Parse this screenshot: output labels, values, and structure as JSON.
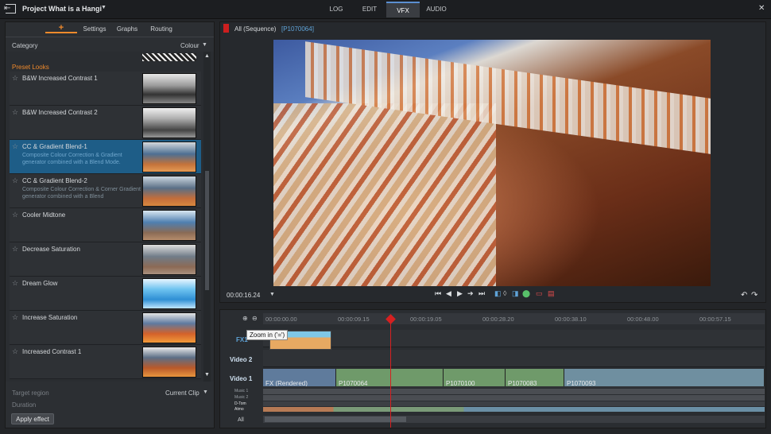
{
  "app": {
    "project_title": "Project What is a Hangi",
    "close": "✕"
  },
  "modes": [
    "LOG",
    "EDIT",
    "VFX",
    "AUDIO"
  ],
  "active_mode": "VFX",
  "left_panel": {
    "tabs": {
      "add": "+",
      "settings": "Settings",
      "graphs": "Graphs",
      "routing": "Routing"
    },
    "category_label": "Category",
    "category_value": "Colour",
    "section": "Preset Looks",
    "items": [
      {
        "label": "B&W Increased Contrast 1",
        "desc": ""
      },
      {
        "label": "B&W Increased Contrast 2",
        "desc": ""
      },
      {
        "label": "CC & Gradient Blend-1",
        "desc": "Composite Colour Correction & Gradient generator combined with a Blend Mode."
      },
      {
        "label": "CC & Gradient Blend-2",
        "desc": "Composite Colour Correction & Corner Gradient generator combined with a Blend"
      },
      {
        "label": "Cooler Midtone",
        "desc": ""
      },
      {
        "label": "Decrease Saturation",
        "desc": ""
      },
      {
        "label": "Dream Glow",
        "desc": ""
      },
      {
        "label": "Increase Saturation",
        "desc": ""
      },
      {
        "label": "Increased Contrast 1",
        "desc": ""
      }
    ],
    "target_region_label": "Target region",
    "target_region_value": "Current Clip",
    "duration_label": "Duration",
    "apply_button": "Apply effect"
  },
  "viewer": {
    "sequence": "All (Sequence)",
    "clip": "[P1070064]",
    "timecode": "00:00:16.24"
  },
  "timeline": {
    "timecodes": [
      "00:00:00.00",
      "00:00:09.15",
      "00:00:19.05",
      "00:00:28.20",
      "00:00:38.10",
      "00:00:48.00",
      "00:00:57.15"
    ],
    "tooltip": "Zoom in ('=')",
    "tracks": {
      "fx1": "FX1",
      "video2": "Video 2",
      "video1": "Video 1",
      "music1": "Music 1",
      "music2": "Music 2",
      "dtom": "D-Tom",
      "atmo": "Atmo",
      "all": "All"
    },
    "clips": [
      "FX (Rendered)",
      "P1070064",
      "P1070100",
      "P1070083",
      "P1070093"
    ]
  },
  "colors": {
    "accent_orange": "#f08a2c",
    "selection_blue": "#1e5d87",
    "playhead_red": "#d62020",
    "active_tab_blue": "#5b8fd1"
  }
}
